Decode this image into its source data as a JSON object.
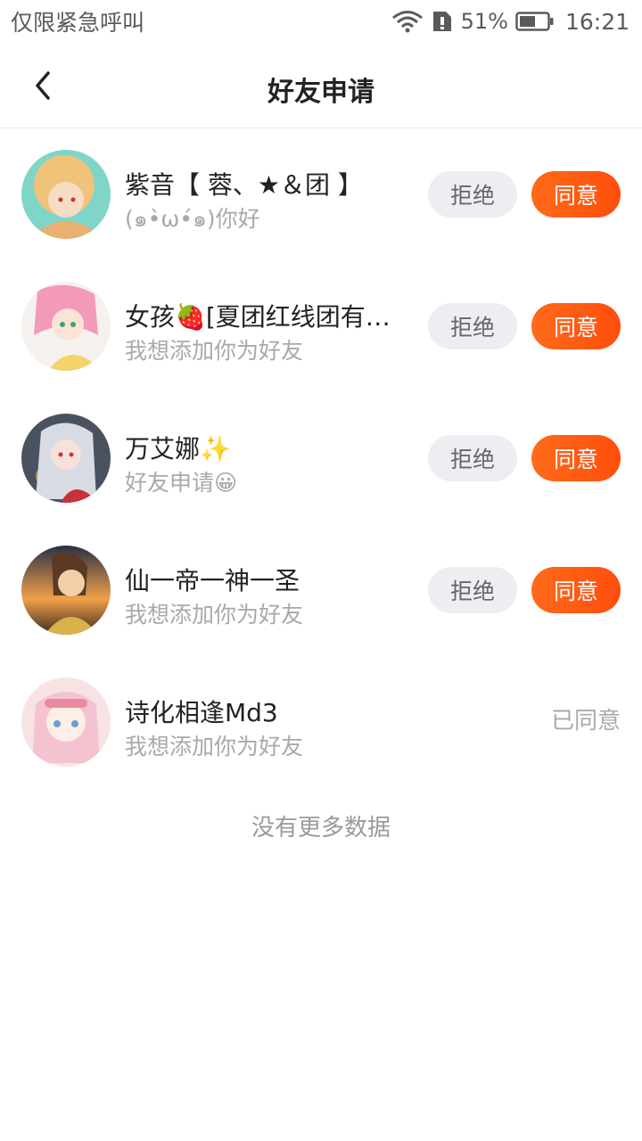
{
  "status_bar": {
    "carrier": "仅限紧急呼叫",
    "battery": "51%",
    "time": "16:21",
    "icons": [
      "wifi-icon",
      "sim-alert-icon",
      "battery-icon"
    ]
  },
  "header": {
    "back_icon": "chevron-left-icon",
    "title": "好友申请"
  },
  "requests": [
    {
      "name": "紫音【 蓉、★＆团 】",
      "message": "(๑•̀ω•́๑)你好",
      "reject_label": "拒绝",
      "accept_label": "同意",
      "status": "pending"
    },
    {
      "name": "女孩🍓[夏团红线团有…",
      "message": "我想添加你为好友",
      "reject_label": "拒绝",
      "accept_label": "同意",
      "status": "pending"
    },
    {
      "name": "万艾娜✨",
      "message": "好友申请😀",
      "reject_label": "拒绝",
      "accept_label": "同意",
      "status": "pending"
    },
    {
      "name": "仙一帝一神一圣",
      "message": "我想添加你为好友",
      "reject_label": "拒绝",
      "accept_label": "同意",
      "status": "pending"
    },
    {
      "name": "诗化相逢Md3",
      "message": "我想添加你为好友",
      "accepted_label": "已同意",
      "status": "accepted"
    }
  ],
  "footer": {
    "no_more": "没有更多数据"
  },
  "colors": {
    "accent": "#ff5a10",
    "reject_bg": "#edeef2",
    "muted_text": "#a9a9a9"
  }
}
